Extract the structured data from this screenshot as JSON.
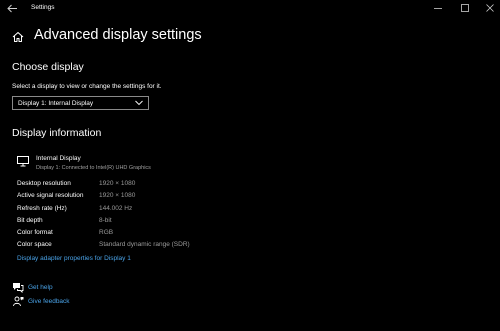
{
  "titlebar": {
    "app_title": "Settings",
    "icons": {
      "back": "back-arrow-icon",
      "minimize": "minimize-icon",
      "maximize": "maximize-icon",
      "close": "close-icon"
    }
  },
  "header": {
    "home_icon": "home-icon",
    "title": "Advanced display settings"
  },
  "choose_display": {
    "heading": "Choose display",
    "hint": "Select a display to view or change the settings for it.",
    "dropdown_value": "Display 1: Internal Display"
  },
  "display_info": {
    "heading": "Display information",
    "monitor_icon": "monitor-icon",
    "name": "Internal Display",
    "subtitle": "Display 1: Connected to Intel(R) UHD Graphics",
    "rows": [
      {
        "label": "Desktop resolution",
        "value": "1920 × 1080"
      },
      {
        "label": "Active signal resolution",
        "value": "1920 × 1080"
      },
      {
        "label": "Refresh rate (Hz)",
        "value": "144.002 Hz"
      },
      {
        "label": "Bit depth",
        "value": "8-bit"
      },
      {
        "label": "Color format",
        "value": "RGB"
      },
      {
        "label": "Color space",
        "value": "Standard dynamic range (SDR)"
      }
    ],
    "adapter_link": "Display adapter properties for Display 1"
  },
  "help": {
    "get_help": "Get help",
    "give_feedback": "Give feedback"
  },
  "colors": {
    "background": "#000000",
    "text": "#ffffff",
    "secondary_text": "#9b9b9b",
    "link": "#4aa3e8"
  }
}
